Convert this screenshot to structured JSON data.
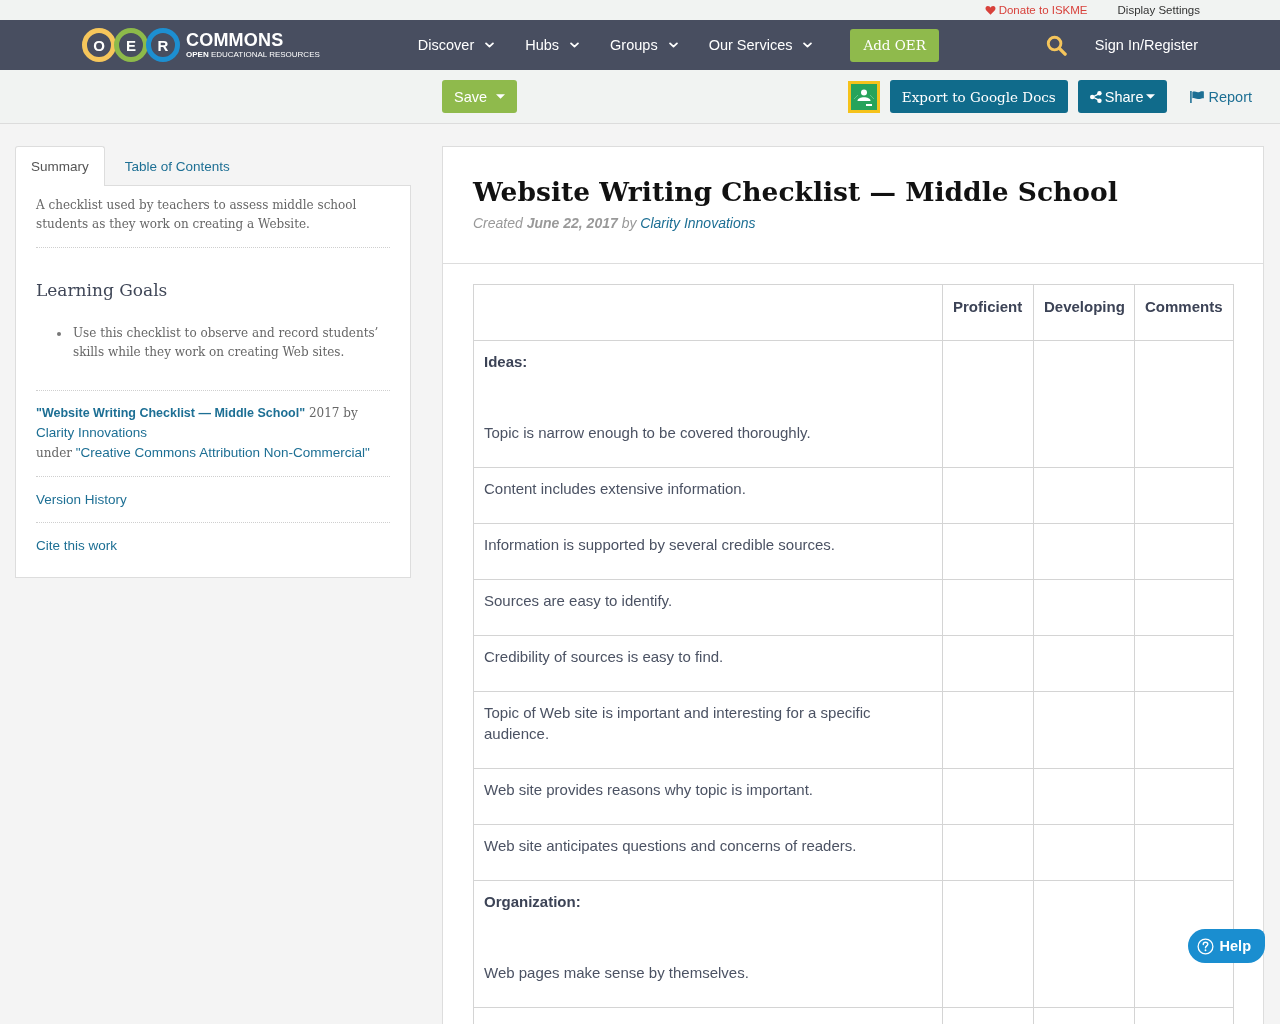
{
  "top_bar": {
    "donate": "Donate to ISKME",
    "display_settings": "Display Settings"
  },
  "nav": {
    "logo": {
      "letters": [
        {
          "letter": "O",
          "color": "#f6c65b"
        },
        {
          "letter": "E",
          "color": "#8dba4a"
        },
        {
          "letter": "R",
          "color": "#1d8fd1"
        }
      ],
      "wordmark": "COMMONS",
      "tagline": "**OPEN** EDUCATIONAL RESOURCES"
    },
    "menu": [
      "Discover",
      "Hubs",
      "Groups",
      "Our Services"
    ],
    "add_button": "Add OER",
    "sign_in": "Sign In/Register"
  },
  "toolbar": {
    "save": "Save",
    "export": "Export to Google Docs",
    "share": "Share",
    "report": "Report"
  },
  "sidebar": {
    "tabs": [
      {
        "label": "Summary",
        "selected": true
      },
      {
        "label": "Table of Contents",
        "selected": false
      }
    ],
    "description": "A checklist used by teachers to assess middle school students as they work on creating a Website.",
    "goals_heading": "Learning Goals",
    "goals": [
      "Use this checklist to observe and record students’ skills while they work on creating Web sites."
    ],
    "license": {
      "title": "\"Website Writing Checklist — Middle School\"",
      "year_by": "2017 by",
      "author": "Clarity Innovations",
      "under": "under",
      "license": "\"Creative Commons Attribution Non-Commercial\""
    },
    "links": [
      "Version History",
      "Cite this work"
    ]
  },
  "resource": {
    "title": "Website Writing Checklist — Middle School",
    "created": "Created **June 22, 2017** by",
    "author": "Clarity Innovations",
    "table": {
      "columns": [
        "Proficient",
        "Developing",
        "Comments"
      ],
      "rows": [
        {
          "kind": "section",
          "heading": "Ideas:",
          "text": "Topic is narrow enough to be covered thoroughly."
        },
        {
          "kind": "item",
          "text": "Content includes extensive information."
        },
        {
          "kind": "item",
          "text": "Information is supported by several credible sources."
        },
        {
          "kind": "item",
          "text": "Sources are easy to identify."
        },
        {
          "kind": "item",
          "text": "Credibility of sources is easy to find."
        },
        {
          "kind": "item",
          "text": "Topic of Web site is important and interesting for a specific audience."
        },
        {
          "kind": "item",
          "text": "Web site provides reasons why topic is important."
        },
        {
          "kind": "item",
          "text": "Web site anticipates questions and concerns of readers."
        },
        {
          "kind": "section",
          "heading": "Organization:",
          "text": "Web pages make sense by themselves."
        }
      ]
    }
  },
  "help_button": "Help"
}
